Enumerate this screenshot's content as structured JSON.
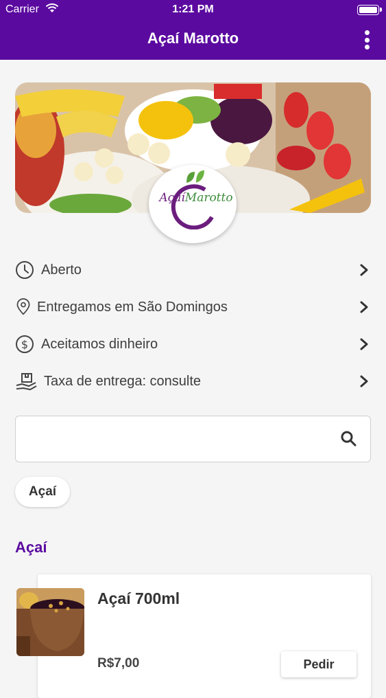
{
  "status_bar": {
    "carrier": "Carrier",
    "time": "1:21 PM"
  },
  "header": {
    "title": "Açaí Marotto"
  },
  "logo": {
    "part1": "Açaí",
    "part2": "Marotto"
  },
  "info": [
    {
      "label": "Aberto",
      "icon": "clock-icon"
    },
    {
      "label": "Entregamos em São Domingos",
      "icon": "location-pin-icon"
    },
    {
      "label": "Aceitamos dinheiro",
      "icon": "dollar-icon"
    },
    {
      "label": "Taxa de entrega: consulte",
      "icon": "delivery-icon"
    }
  ],
  "search": {
    "placeholder": "",
    "value": ""
  },
  "categories": [
    "Açaí"
  ],
  "section": {
    "title": "Açaí"
  },
  "products": [
    {
      "name": "Açaí 700ml",
      "price": "R$7,00",
      "button": "Pedir"
    }
  ],
  "colors": {
    "primary": "#5b0aa0",
    "background": "#f5f5f5"
  }
}
